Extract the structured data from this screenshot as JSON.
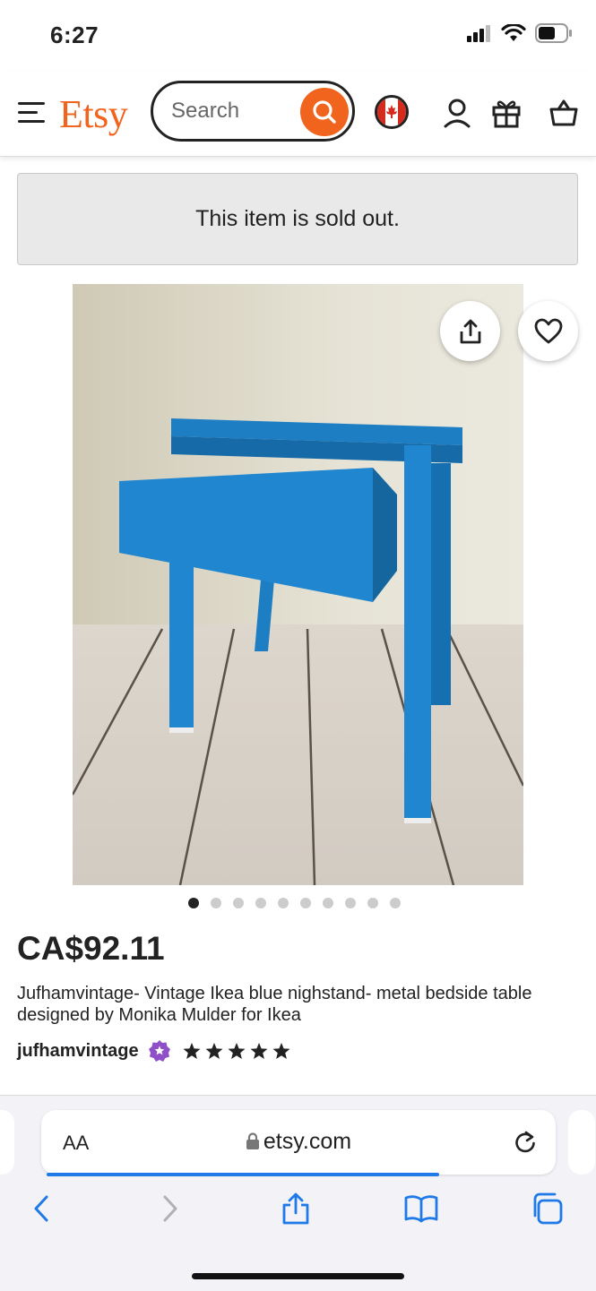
{
  "status_bar": {
    "time": "6:27"
  },
  "header": {
    "logo": "Etsy",
    "search_placeholder": "Search",
    "brand_color": "#f1641e"
  },
  "banner": {
    "text": "This item is sold out."
  },
  "product": {
    "image_count": 10,
    "active_image": 1,
    "price": "CA$92.11",
    "title": "Jufhamvintage- Vintage Ikea blue nighstand- metal bedside table designed by Monika Mulder for Ikea",
    "shop_name": "jufhamvintage",
    "rating": 5,
    "rating_max": 5
  },
  "browser": {
    "text_size_label": "AA",
    "url": "etsy.com",
    "progress": 0.78
  }
}
